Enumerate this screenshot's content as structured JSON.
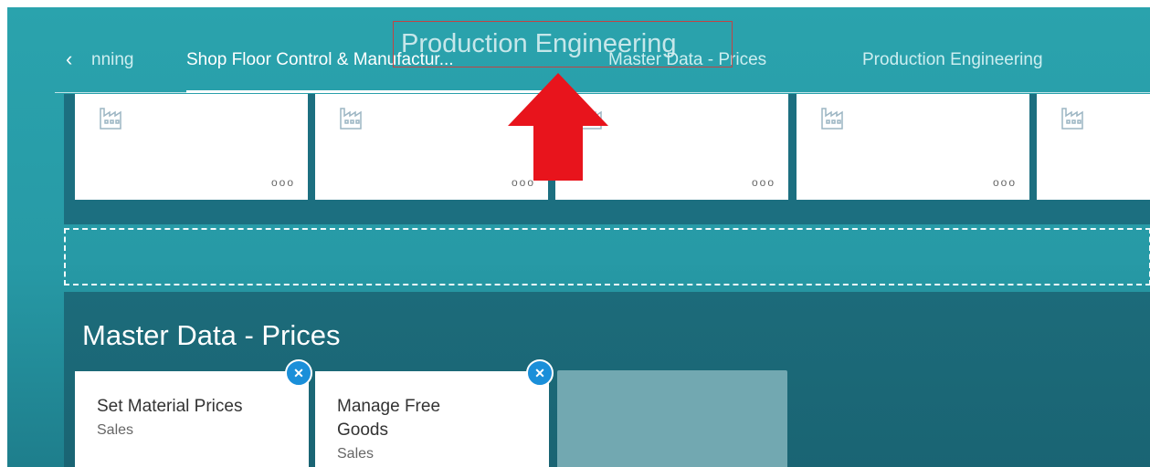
{
  "nav": {
    "back_icon": "chevron-left-icon",
    "tabs": [
      {
        "label": "nning"
      },
      {
        "label": "Shop Floor Control & Manufactur..."
      },
      {
        "label": "Master Data - Prices"
      },
      {
        "label": "Production Engineering"
      }
    ],
    "active_tab_index": 1
  },
  "group1": {
    "tiles": [
      {
        "icon": "factory-icon",
        "more": "ooo"
      },
      {
        "icon": "factory-icon",
        "more": "ooo"
      },
      {
        "icon": "factory-icon",
        "more": "ooo"
      },
      {
        "icon": "factory-icon",
        "more": "ooo"
      },
      {
        "icon": "factory-icon",
        "more": ""
      }
    ]
  },
  "group2": {
    "title": "Master Data - Prices",
    "tiles": [
      {
        "title": "Set Material Prices",
        "subtitle": "Sales",
        "remove": "✕"
      },
      {
        "title_line1": "Manage Free",
        "title_line2": "Goods",
        "subtitle": "Sales",
        "remove": "✕"
      }
    ]
  },
  "drag_ghost": {
    "label": "Production Engineering"
  },
  "colors": {
    "accent": "#1a8fd9",
    "arrow": "#e8141c",
    "background": "#2aa3ad"
  }
}
